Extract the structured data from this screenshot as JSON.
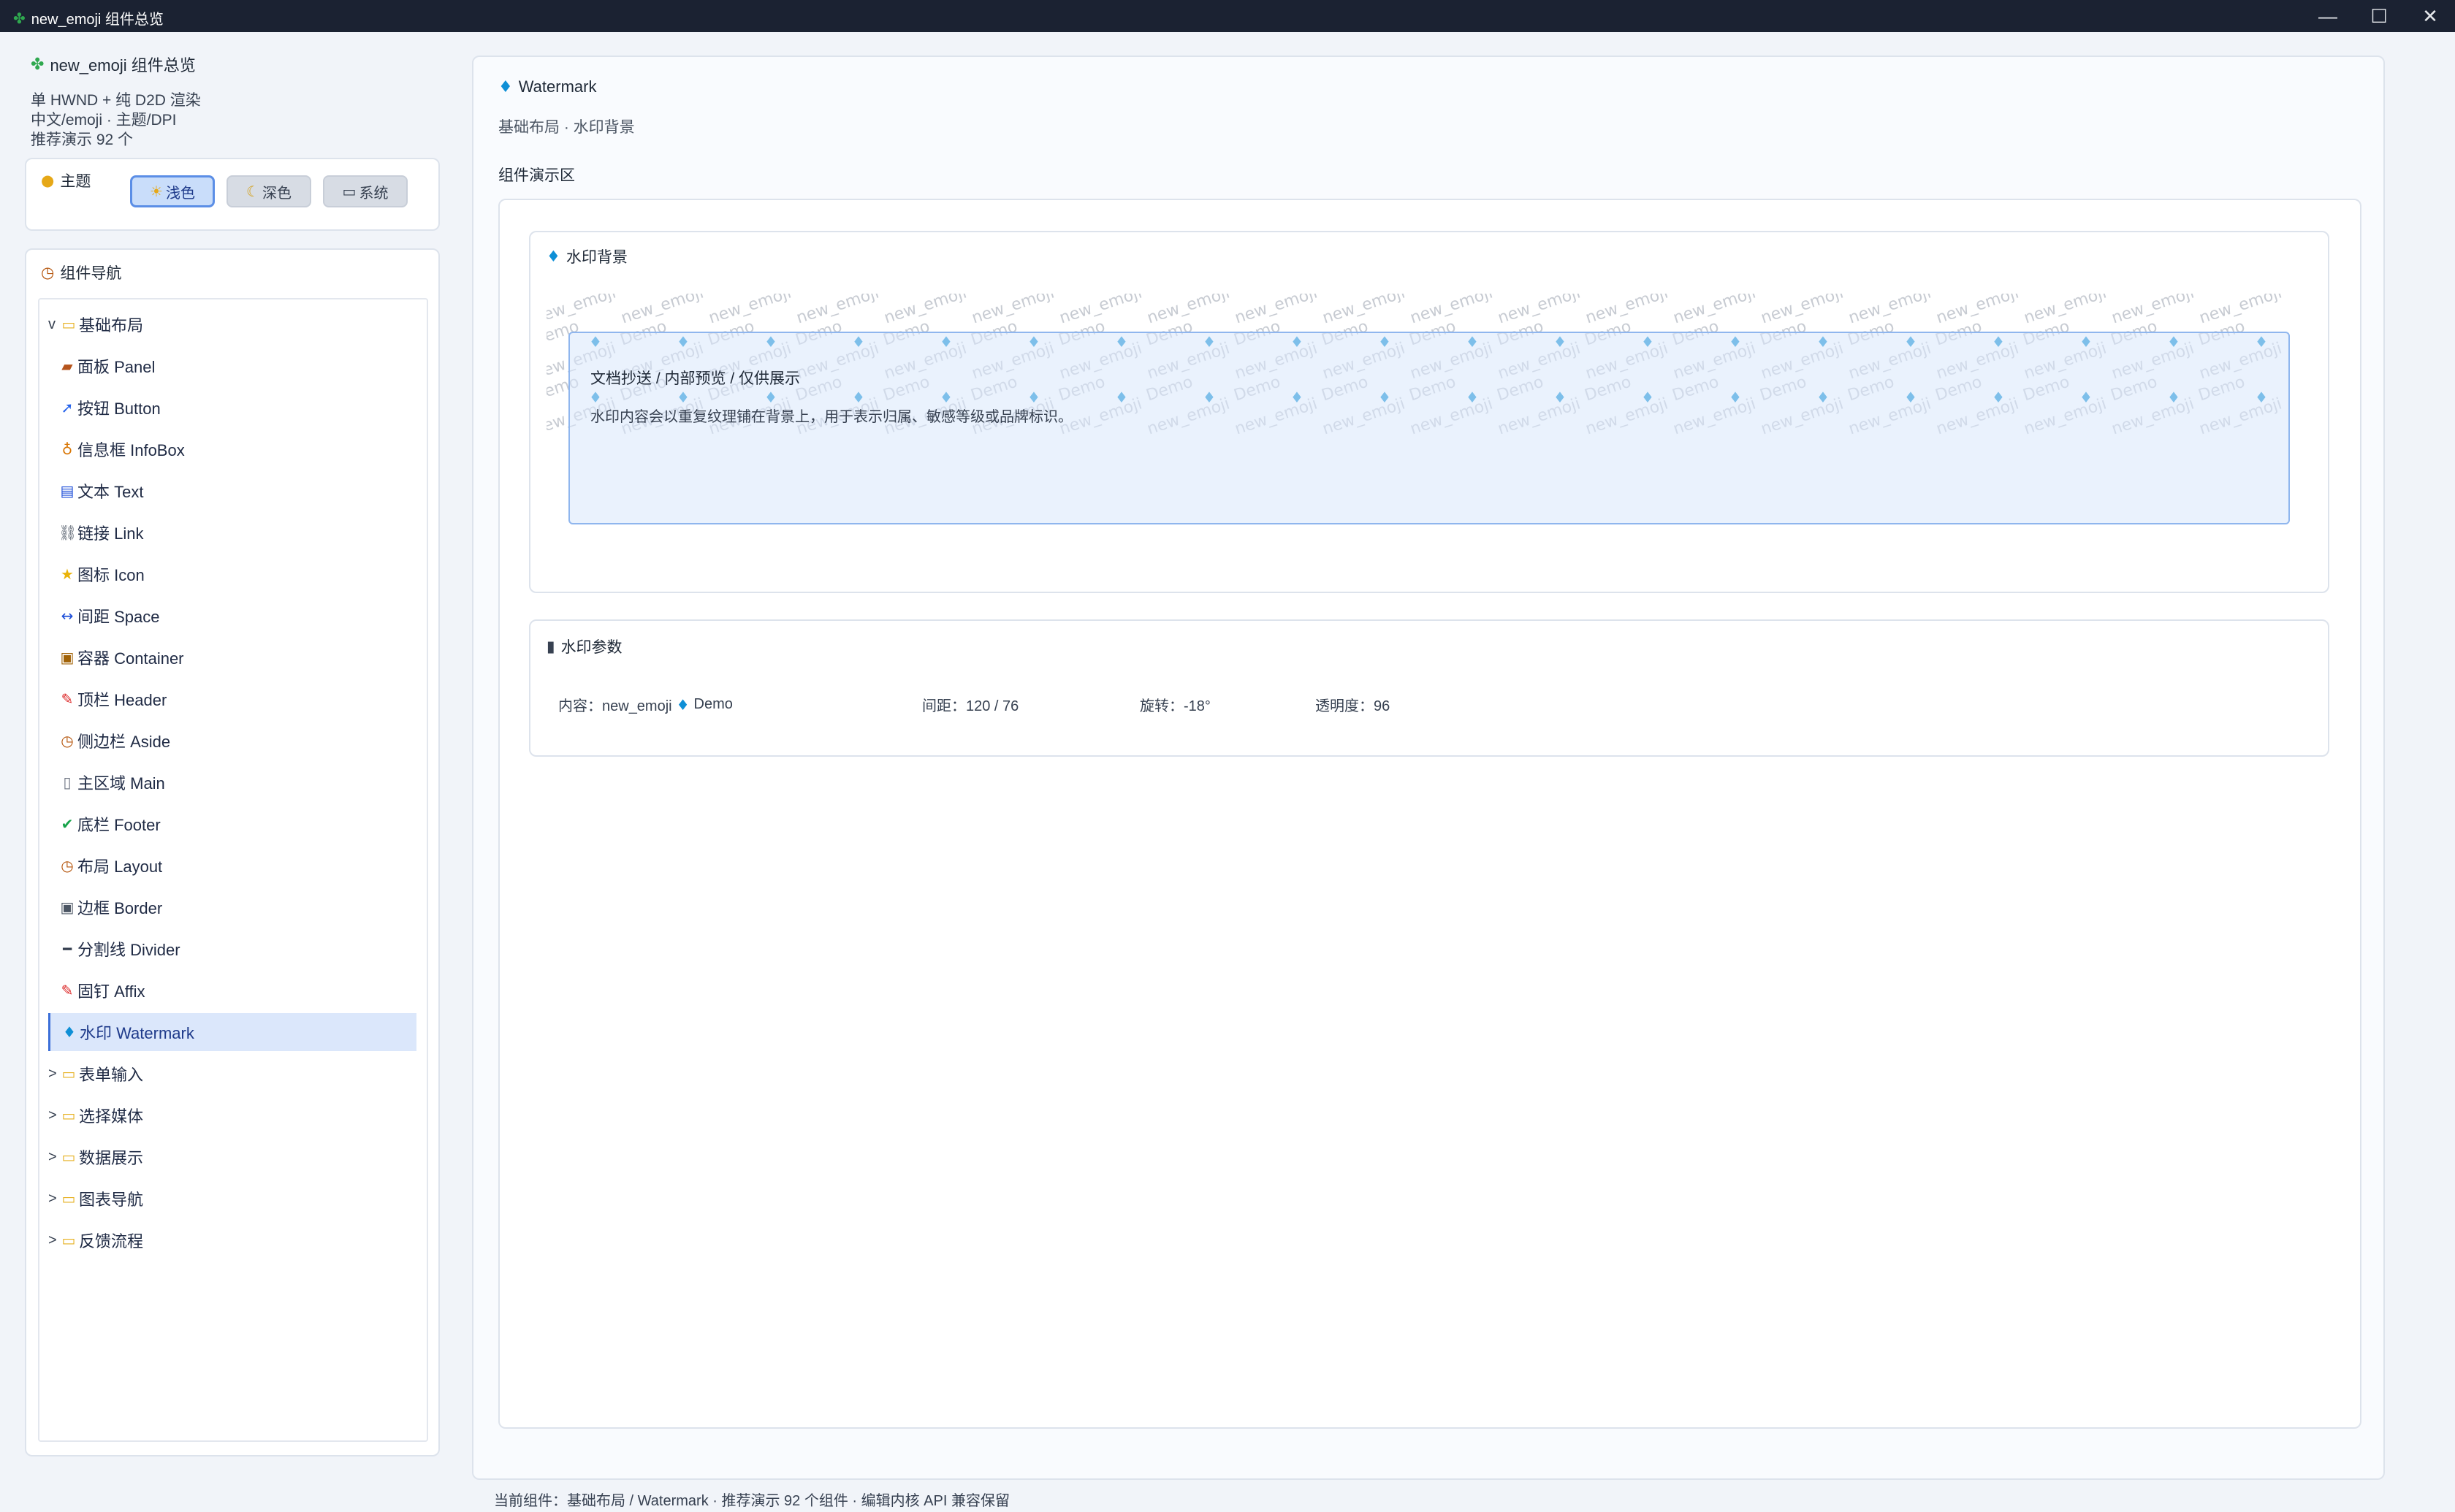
{
  "window": {
    "title": "new_emoji 组件总览",
    "icon": "clover-icon",
    "controls": {
      "minimize": "—",
      "maximize": "☐",
      "close": "✕"
    }
  },
  "sidebar": {
    "app_title": "new_emoji 组件总览",
    "info_lines": [
      "单 HWND + 纯 D2D 渲染",
      "中文/emoji · 主题/DPI",
      "推荐演示 92 个"
    ],
    "theme": {
      "label": "主题",
      "buttons": [
        {
          "label": "浅色",
          "icon": "☀",
          "active": true
        },
        {
          "label": "深色",
          "icon": "☾",
          "active": false
        },
        {
          "label": "系统",
          "icon": "▭",
          "active": false
        }
      ]
    },
    "nav": {
      "label": "组件导航",
      "group_open": {
        "chevron": "v",
        "label": "基础布局"
      },
      "items": [
        {
          "icon": "▰",
          "icon_name": "panel-icon",
          "label": "面板 Panel",
          "color": "#b5541c"
        },
        {
          "icon": "➚",
          "icon_name": "rocket-icon",
          "label": "按钮 Button",
          "color": "#2563eb"
        },
        {
          "icon": "♁",
          "icon_name": "bulb-icon",
          "label": "信息框 InfoBox",
          "color": "#d97706"
        },
        {
          "icon": "▤",
          "icon_name": "text-icon",
          "label": "文本 Text",
          "color": "#1d4ed8"
        },
        {
          "icon": "⛓",
          "icon_name": "link-icon",
          "label": "链接 Link",
          "color": "#4b5563"
        },
        {
          "icon": "★",
          "icon_name": "star-icon",
          "label": "图标 Icon",
          "color": "#eab308"
        },
        {
          "icon": "↔",
          "icon_name": "space-icon",
          "label": "间距 Space",
          "color": "#1d4ed8"
        },
        {
          "icon": "▣",
          "icon_name": "box-icon",
          "label": "容器 Container",
          "color": "#a16207"
        },
        {
          "icon": "✎",
          "icon_name": "pin-icon",
          "label": "顶栏 Header",
          "color": "#dc2626"
        },
        {
          "icon": "◷",
          "icon_name": "clock-icon",
          "label": "侧边栏 Aside",
          "color": "#b45309"
        },
        {
          "icon": "▯",
          "icon_name": "page-icon",
          "label": "主区域 Main",
          "color": "#6b7280"
        },
        {
          "icon": "✔",
          "icon_name": "check-icon",
          "label": "底栏 Footer",
          "color": "#16a34a"
        },
        {
          "icon": "◷",
          "icon_name": "clock-icon",
          "label": "布局 Layout",
          "color": "#b45309"
        },
        {
          "icon": "▣",
          "icon_name": "border-icon",
          "label": "边框 Border",
          "color": "#4b5563"
        },
        {
          "icon": "━",
          "icon_name": "divider-icon",
          "label": "分割线 Divider",
          "color": "#374151"
        },
        {
          "icon": "✎",
          "icon_name": "pushpin-icon",
          "label": "固钉 Affix",
          "color": "#dc2626"
        },
        {
          "icon": "♦",
          "icon_name": "droplet-icon",
          "label": "水印 Watermark",
          "color": "#0e8fd6",
          "selected": true
        }
      ],
      "groups_closed": [
        {
          "chevron": ">",
          "label": "表单输入"
        },
        {
          "chevron": ">",
          "label": "选择媒体"
        },
        {
          "chevron": ">",
          "label": "数据展示"
        },
        {
          "chevron": ">",
          "label": "图表导航"
        },
        {
          "chevron": ">",
          "label": "反馈流程"
        }
      ]
    }
  },
  "main": {
    "title": "Watermark",
    "breadcrumb": "基础布局 · 水印背景",
    "demo_label": "组件演示区",
    "watermark_card": {
      "title": "水印背景",
      "wm_text": "new_emoji",
      "wm_text2": "Demo",
      "inner_title": "文档抄送 / 内部预览 / 仅供展示",
      "inner_desc": "水印内容会以重复纹理铺在背景上，用于表示归属、敏感等级或品牌标识。"
    },
    "params_card": {
      "title": "水印参数",
      "content_label": "内容：new_emoji",
      "content_suffix": "Demo",
      "gap": "间距：120 / 76",
      "rotate": "旋转：-18°",
      "opacity": "透明度：96"
    },
    "status": "当前组件：基础布局 / Watermark · 推荐演示 92 个组件 · 编辑内核 API 兼容保留"
  }
}
